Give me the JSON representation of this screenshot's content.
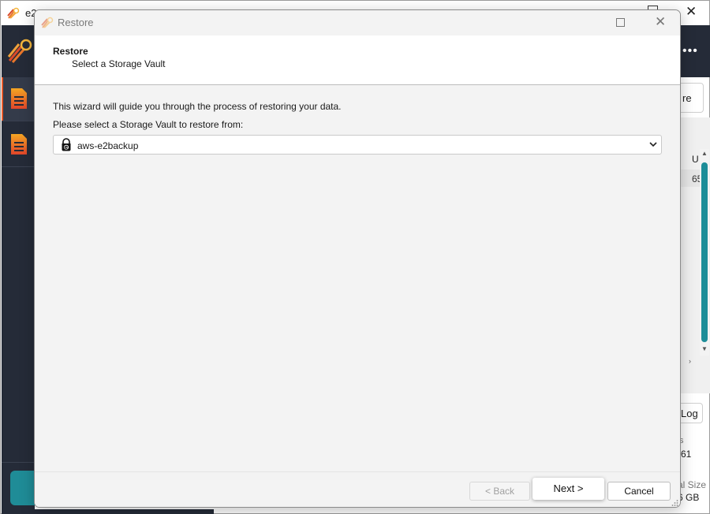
{
  "background_app": {
    "title": "e2",
    "restore_button_partial": "re",
    "column_header_partial": "U",
    "row_value_partial": "65",
    "log_button_partial": "Log",
    "label_s_partial": "s",
    "value_61_partial": "61",
    "total_size_partial": "al Size",
    "size_value_partial": "6 GB",
    "more_icon": "ellipsis-icon"
  },
  "dialog": {
    "title": "Restore",
    "header": {
      "title": "Restore",
      "subtitle": "Select a Storage Vault"
    },
    "intro_text": "This wizard will guide you through the process of restoring your data.",
    "vault_prompt": "Please select a Storage Vault to restore from:",
    "vault_select": {
      "selected": "aws-e2backup",
      "icon": "lock-cloud-icon"
    },
    "buttons": {
      "back": "< Back",
      "next": "Next >",
      "cancel": "Cancel"
    }
  },
  "colors": {
    "sidebar": "#252b38",
    "accent_teal": "#1d8d98",
    "accent_orange": "#e85a2a"
  }
}
